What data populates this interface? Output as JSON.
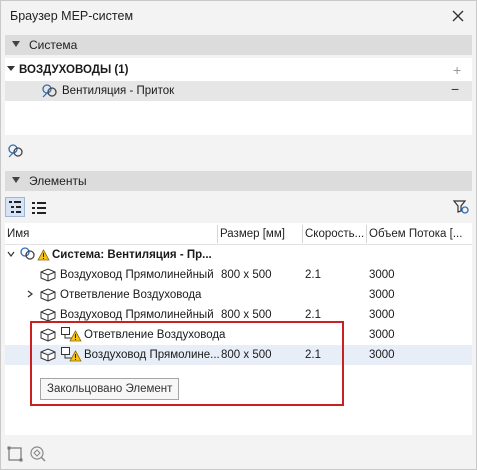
{
  "window": {
    "title": "Браузер MEP-систем"
  },
  "system_section": {
    "label": "Система",
    "group_title": "ВОЗДУХОВОДЫ (1)",
    "add_glyph": "+",
    "remove_glyph": "−",
    "item": "Вентиляция - Приток"
  },
  "elements_section": {
    "label": "Элементы",
    "columns": [
      "Имя",
      "Размер [мм]",
      "Скорость...",
      "Объем Потока [..."
    ],
    "rows": [
      {
        "name": "Система: Вентиляция - Пр...",
        "size": "",
        "speed": "",
        "flow": ""
      },
      {
        "name": "Воздуховод Прямолинейный",
        "size": "800 x 500",
        "speed": "2.1",
        "flow": "3000"
      },
      {
        "name": "Ответвление Воздуховода",
        "size": "",
        "speed": "",
        "flow": "3000"
      },
      {
        "name": "Воздуховод Прямолинейный",
        "size": "800 x 500",
        "speed": "2.1",
        "flow": "3000"
      },
      {
        "name": "Ответвление Воздуховода",
        "size": "",
        "speed": "",
        "flow": "3000"
      },
      {
        "name": "Воздуховод Прямолине...",
        "size": "800 x 500",
        "speed": "2.1",
        "flow": "3000"
      }
    ],
    "tooltip": "Закольцовано Элемент"
  }
}
